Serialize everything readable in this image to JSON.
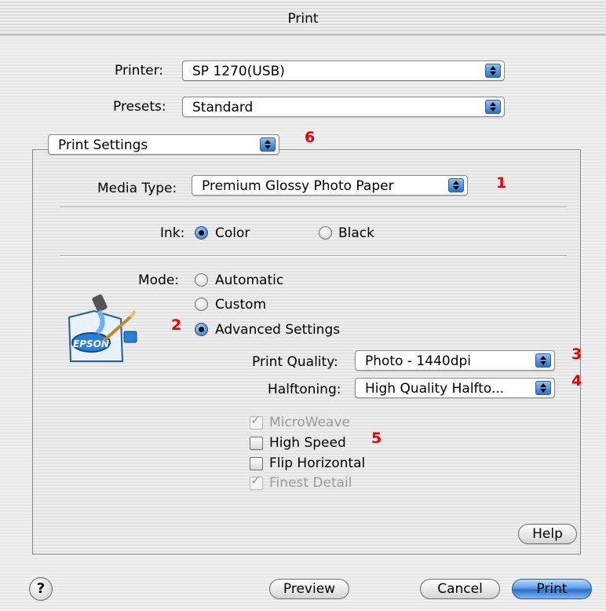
{
  "window": {
    "title": "Print"
  },
  "printer": {
    "label": "Printer:",
    "value": "SP 1270(USB)"
  },
  "presets": {
    "label": "Presets:",
    "value": "Standard"
  },
  "section_popup": {
    "value": "Print Settings"
  },
  "media": {
    "label": "Media Type:",
    "value": "Premium Glossy Photo Paper"
  },
  "ink": {
    "label": "Ink:",
    "options": [
      "Color",
      "Black"
    ],
    "selected": "Color"
  },
  "mode": {
    "label": "Mode:",
    "options": [
      "Automatic",
      "Custom",
      "Advanced Settings"
    ],
    "selected": "Advanced Settings"
  },
  "logo": {
    "text": "EPSON"
  },
  "quality": {
    "label": "Print Quality:",
    "value": "Photo - 1440dpi"
  },
  "halftoning": {
    "label": "Halftoning:",
    "value": "High Quality Halfto..."
  },
  "checkboxes": [
    {
      "label": "MicroWeave",
      "checked": true,
      "disabled": true
    },
    {
      "label": "High Speed",
      "checked": false,
      "disabled": false
    },
    {
      "label": "Flip Horizontal",
      "checked": false,
      "disabled": false
    },
    {
      "label": "Finest Detail",
      "checked": true,
      "disabled": true
    }
  ],
  "callouts": {
    "c1": "1",
    "c2": "2",
    "c3": "3",
    "c4": "4",
    "c5": "5",
    "c6": "6"
  },
  "buttons": {
    "help": "Help",
    "preview": "Preview",
    "cancel": "Cancel",
    "print": "Print",
    "question": "?"
  },
  "colors": {
    "accent": "#2e73c9",
    "callout": "#e60000"
  }
}
